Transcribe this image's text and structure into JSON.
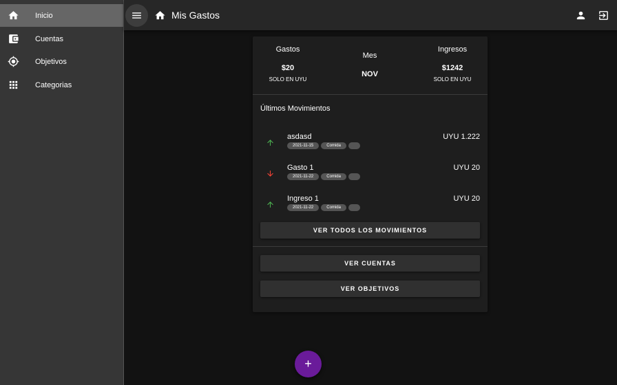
{
  "sidebar": {
    "items": [
      {
        "label": "Inicio",
        "icon": "home-icon",
        "active": true
      },
      {
        "label": "Cuentas",
        "icon": "wallet-icon"
      },
      {
        "label": "Objetivos",
        "icon": "target-icon"
      },
      {
        "label": "Categorias",
        "icon": "grid-icon"
      }
    ]
  },
  "header": {
    "title": "Mis Gastos",
    "icons": [
      "menu-icon",
      "home-icon",
      "user-icon",
      "logout-icon"
    ]
  },
  "summary": {
    "gastos": {
      "title": "Gastos",
      "value": "$20",
      "sub": "SOLO EN UYU"
    },
    "mes": {
      "title": "Mes",
      "value": "NOV"
    },
    "ingresos": {
      "title": "Ingresos",
      "value": "$1242",
      "sub": "SOLO EN UYU"
    }
  },
  "movements": {
    "title": "Últimos Movimientos",
    "items": [
      {
        "name": "asdasd",
        "date": "2021-11-15",
        "category": "Comida",
        "amount": "UYU 1.222",
        "direction": "up"
      },
      {
        "name": "Gasto 1",
        "date": "2021-11-22",
        "category": "Comida",
        "amount": "UYU 20",
        "direction": "down"
      },
      {
        "name": "Ingreso 1",
        "date": "2021-11-22",
        "category": "Comida",
        "amount": "UYU 20",
        "direction": "up"
      }
    ],
    "view_all_label": "VER TODOS LOS MOVIMIENTOS"
  },
  "actions": {
    "accounts_label": "VER CUENTAS",
    "goals_label": "VER OBJETIVOS"
  },
  "fab": {
    "label": "+"
  },
  "colors": {
    "background": "#121212",
    "sidebar": "#363636",
    "card": "#1e1e1e",
    "up": "#4caf50",
    "down": "#f44336",
    "fab": "#6a1b9a"
  }
}
